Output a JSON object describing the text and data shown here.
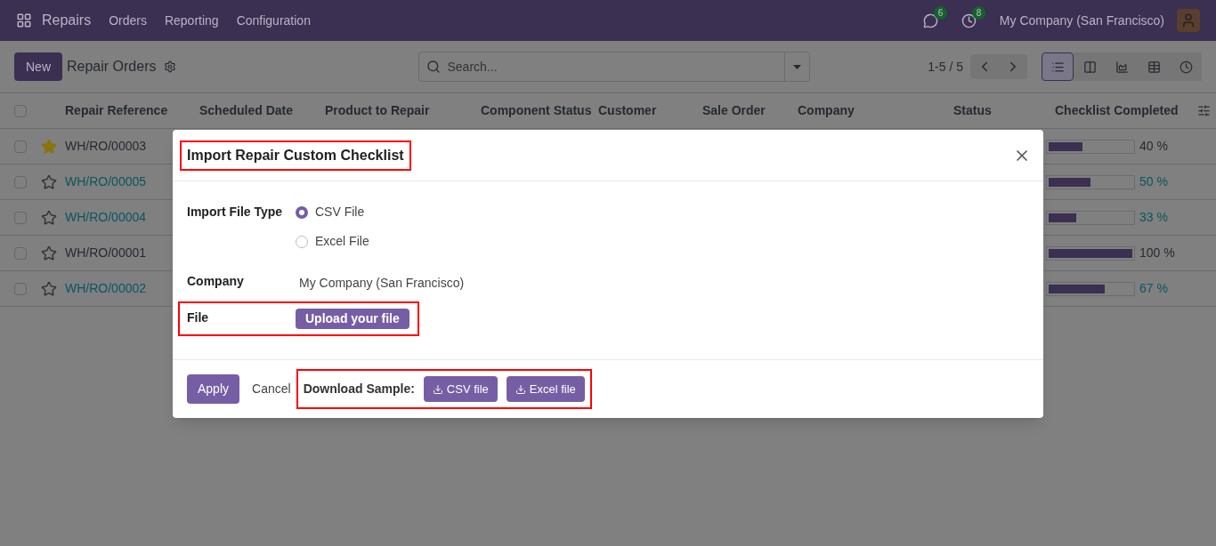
{
  "navbar": {
    "app": "Repairs",
    "menu": [
      "Orders",
      "Reporting",
      "Configuration"
    ],
    "messages_badge": "6",
    "activities_badge": "8",
    "company": "My Company (San Francisco)"
  },
  "control_panel": {
    "new_button": "New",
    "title": "Repair Orders",
    "search": {
      "placeholder": "Search..."
    },
    "pager": "1-5 / 5",
    "views": [
      {
        "kind": "list",
        "selected": true
      },
      {
        "kind": "kanban",
        "selected": false
      },
      {
        "kind": "graph",
        "selected": false
      },
      {
        "kind": "pivot",
        "selected": false
      },
      {
        "kind": "activity",
        "selected": false
      }
    ]
  },
  "table": {
    "select_all_checked": false,
    "columns": [
      "Repair Reference",
      "Scheduled Date",
      "Product to Repair",
      "Component Status",
      "Customer",
      "Sale Order",
      "Company",
      "Status",
      "Checklist Completed"
    ],
    "rows": [
      {
        "checked": false,
        "reference": "WH/RO/00003",
        "starred": true,
        "color": "#262a30",
        "level": 0.4,
        "percent": "40 %"
      },
      {
        "checked": false,
        "reference": "WH/RO/00005",
        "starred": false,
        "color": "#0b5560",
        "level": 0.5,
        "percent": "50 %"
      },
      {
        "checked": false,
        "reference": "WH/RO/00004",
        "starred": false,
        "color": "#0b5560",
        "level": 0.33,
        "percent": "33 %"
      },
      {
        "checked": false,
        "reference": "WH/RO/00001",
        "starred": false,
        "color": "#262a30",
        "level": 1,
        "percent": "100 %"
      },
      {
        "checked": false,
        "reference": "WH/RO/00002",
        "starred": false,
        "color": "#0b5560",
        "level": 0.67,
        "percent": "67 %"
      }
    ]
  },
  "dialog": {
    "title": "Import Repair Custom Checklist",
    "title_highlighted": true,
    "import_type": {
      "label": "Import File Type",
      "options": [
        {
          "label": "CSV File",
          "selected": true
        },
        {
          "label": "Excel File",
          "selected": false
        }
      ]
    },
    "company": {
      "label": "Company",
      "value": "My Company (San Francisco)"
    },
    "file": {
      "label": "File",
      "button": "Upload your file",
      "highlighted": true
    },
    "apply": "Apply",
    "cancel": "Cancel",
    "download": {
      "label": "Download Sample:",
      "buttons": [
        "CSV file",
        "Excel file"
      ],
      "highlighted": true
    }
  }
}
